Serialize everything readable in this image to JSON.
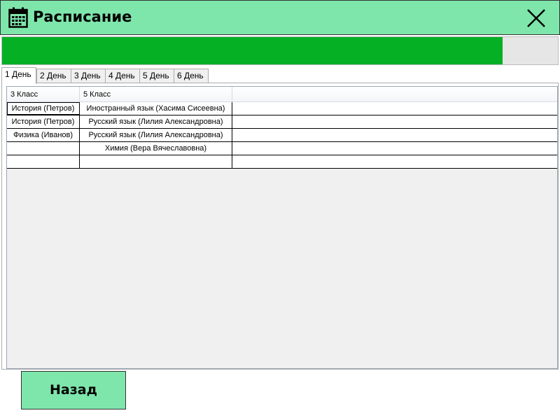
{
  "window": {
    "title": "Расписание",
    "icon": "calendar-icon",
    "close_icon": "close-icon"
  },
  "progress": {
    "fraction": 0.9
  },
  "tabs": [
    {
      "label": "1 День",
      "active": true
    },
    {
      "label": "2 День",
      "active": false
    },
    {
      "label": "3 День",
      "active": false
    },
    {
      "label": "4 День",
      "active": false
    },
    {
      "label": "5 День",
      "active": false
    },
    {
      "label": "6 День",
      "active": false
    }
  ],
  "grid": {
    "columns": [
      "3 Класс",
      "5 Класс",
      ""
    ],
    "rows": [
      [
        "История (Петров)",
        "Иностранный язык (Хасима Сисеевна)",
        ""
      ],
      [
        "История (Петров)",
        "Русский язык (Лилия Александровна)",
        ""
      ],
      [
        "Физика (Иванов)",
        "Русский язык (Лилия Александровна)",
        ""
      ],
      [
        "",
        "Химия (Вера Вячеславовна)",
        ""
      ],
      [
        "",
        "",
        ""
      ]
    ]
  },
  "footer": {
    "back_label": "Назад"
  },
  "colors": {
    "accent": "#7ee6ab",
    "progress": "#06b025"
  }
}
